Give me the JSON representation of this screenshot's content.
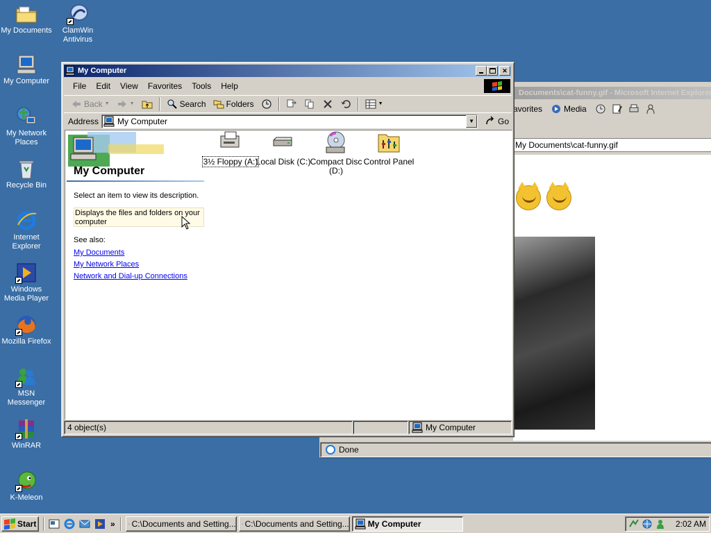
{
  "desktop": {
    "icons": [
      {
        "label": "My Documents"
      },
      {
        "label": "ClamWin Antivirus"
      },
      {
        "label": "My Computer"
      },
      {
        "label": "My Network Places"
      },
      {
        "label": "Recycle Bin"
      },
      {
        "label": "Internet Explorer"
      },
      {
        "label": "Windows Media Player"
      },
      {
        "label": "Mozilla Firefox"
      },
      {
        "label": "MSN Messenger"
      },
      {
        "label": "WinRAR"
      },
      {
        "label": "K-Meleon"
      }
    ]
  },
  "ie_window": {
    "title": "Documents\\cat-funny.gif - Microsoft Internet Explorer",
    "toolbar": {
      "favorites": "avorites",
      "media": "Media"
    },
    "address": "My Documents\\cat-funny.gif",
    "status": "Done"
  },
  "mc_window": {
    "title": "My Computer",
    "menu": [
      "File",
      "Edit",
      "View",
      "Favorites",
      "Tools",
      "Help"
    ],
    "toolbar": {
      "back": "Back",
      "search": "Search",
      "folders": "Folders"
    },
    "address_label": "Address",
    "address_value": "My Computer",
    "go_label": "Go",
    "left_pane": {
      "title": "My Computer",
      "select_hint": "Select an item to view its description.",
      "description": "Displays the files and folders on your computer",
      "see_also": "See also:",
      "links": [
        "My Documents",
        "My Network Places",
        "Network and Dial-up Connections"
      ]
    },
    "items": [
      {
        "label": "3½ Floppy (A:)"
      },
      {
        "label": "Local Disk (C:)"
      },
      {
        "label": "Compact Disc (D:)"
      },
      {
        "label": "Control Panel"
      }
    ],
    "status": {
      "count": "4 object(s)",
      "zone": "My Computer"
    }
  },
  "taskbar": {
    "start": "Start",
    "tasks": [
      {
        "label": "C:\\Documents and Setting..."
      },
      {
        "label": "C:\\Documents and Setting..."
      },
      {
        "label": "My Computer"
      }
    ],
    "clock": "2:02 AM"
  },
  "colors": {
    "desktop": "#3a6ea5",
    "titlebar_active": "#0a246a",
    "chrome": "#d4d0c8",
    "link": "#0000ee"
  }
}
